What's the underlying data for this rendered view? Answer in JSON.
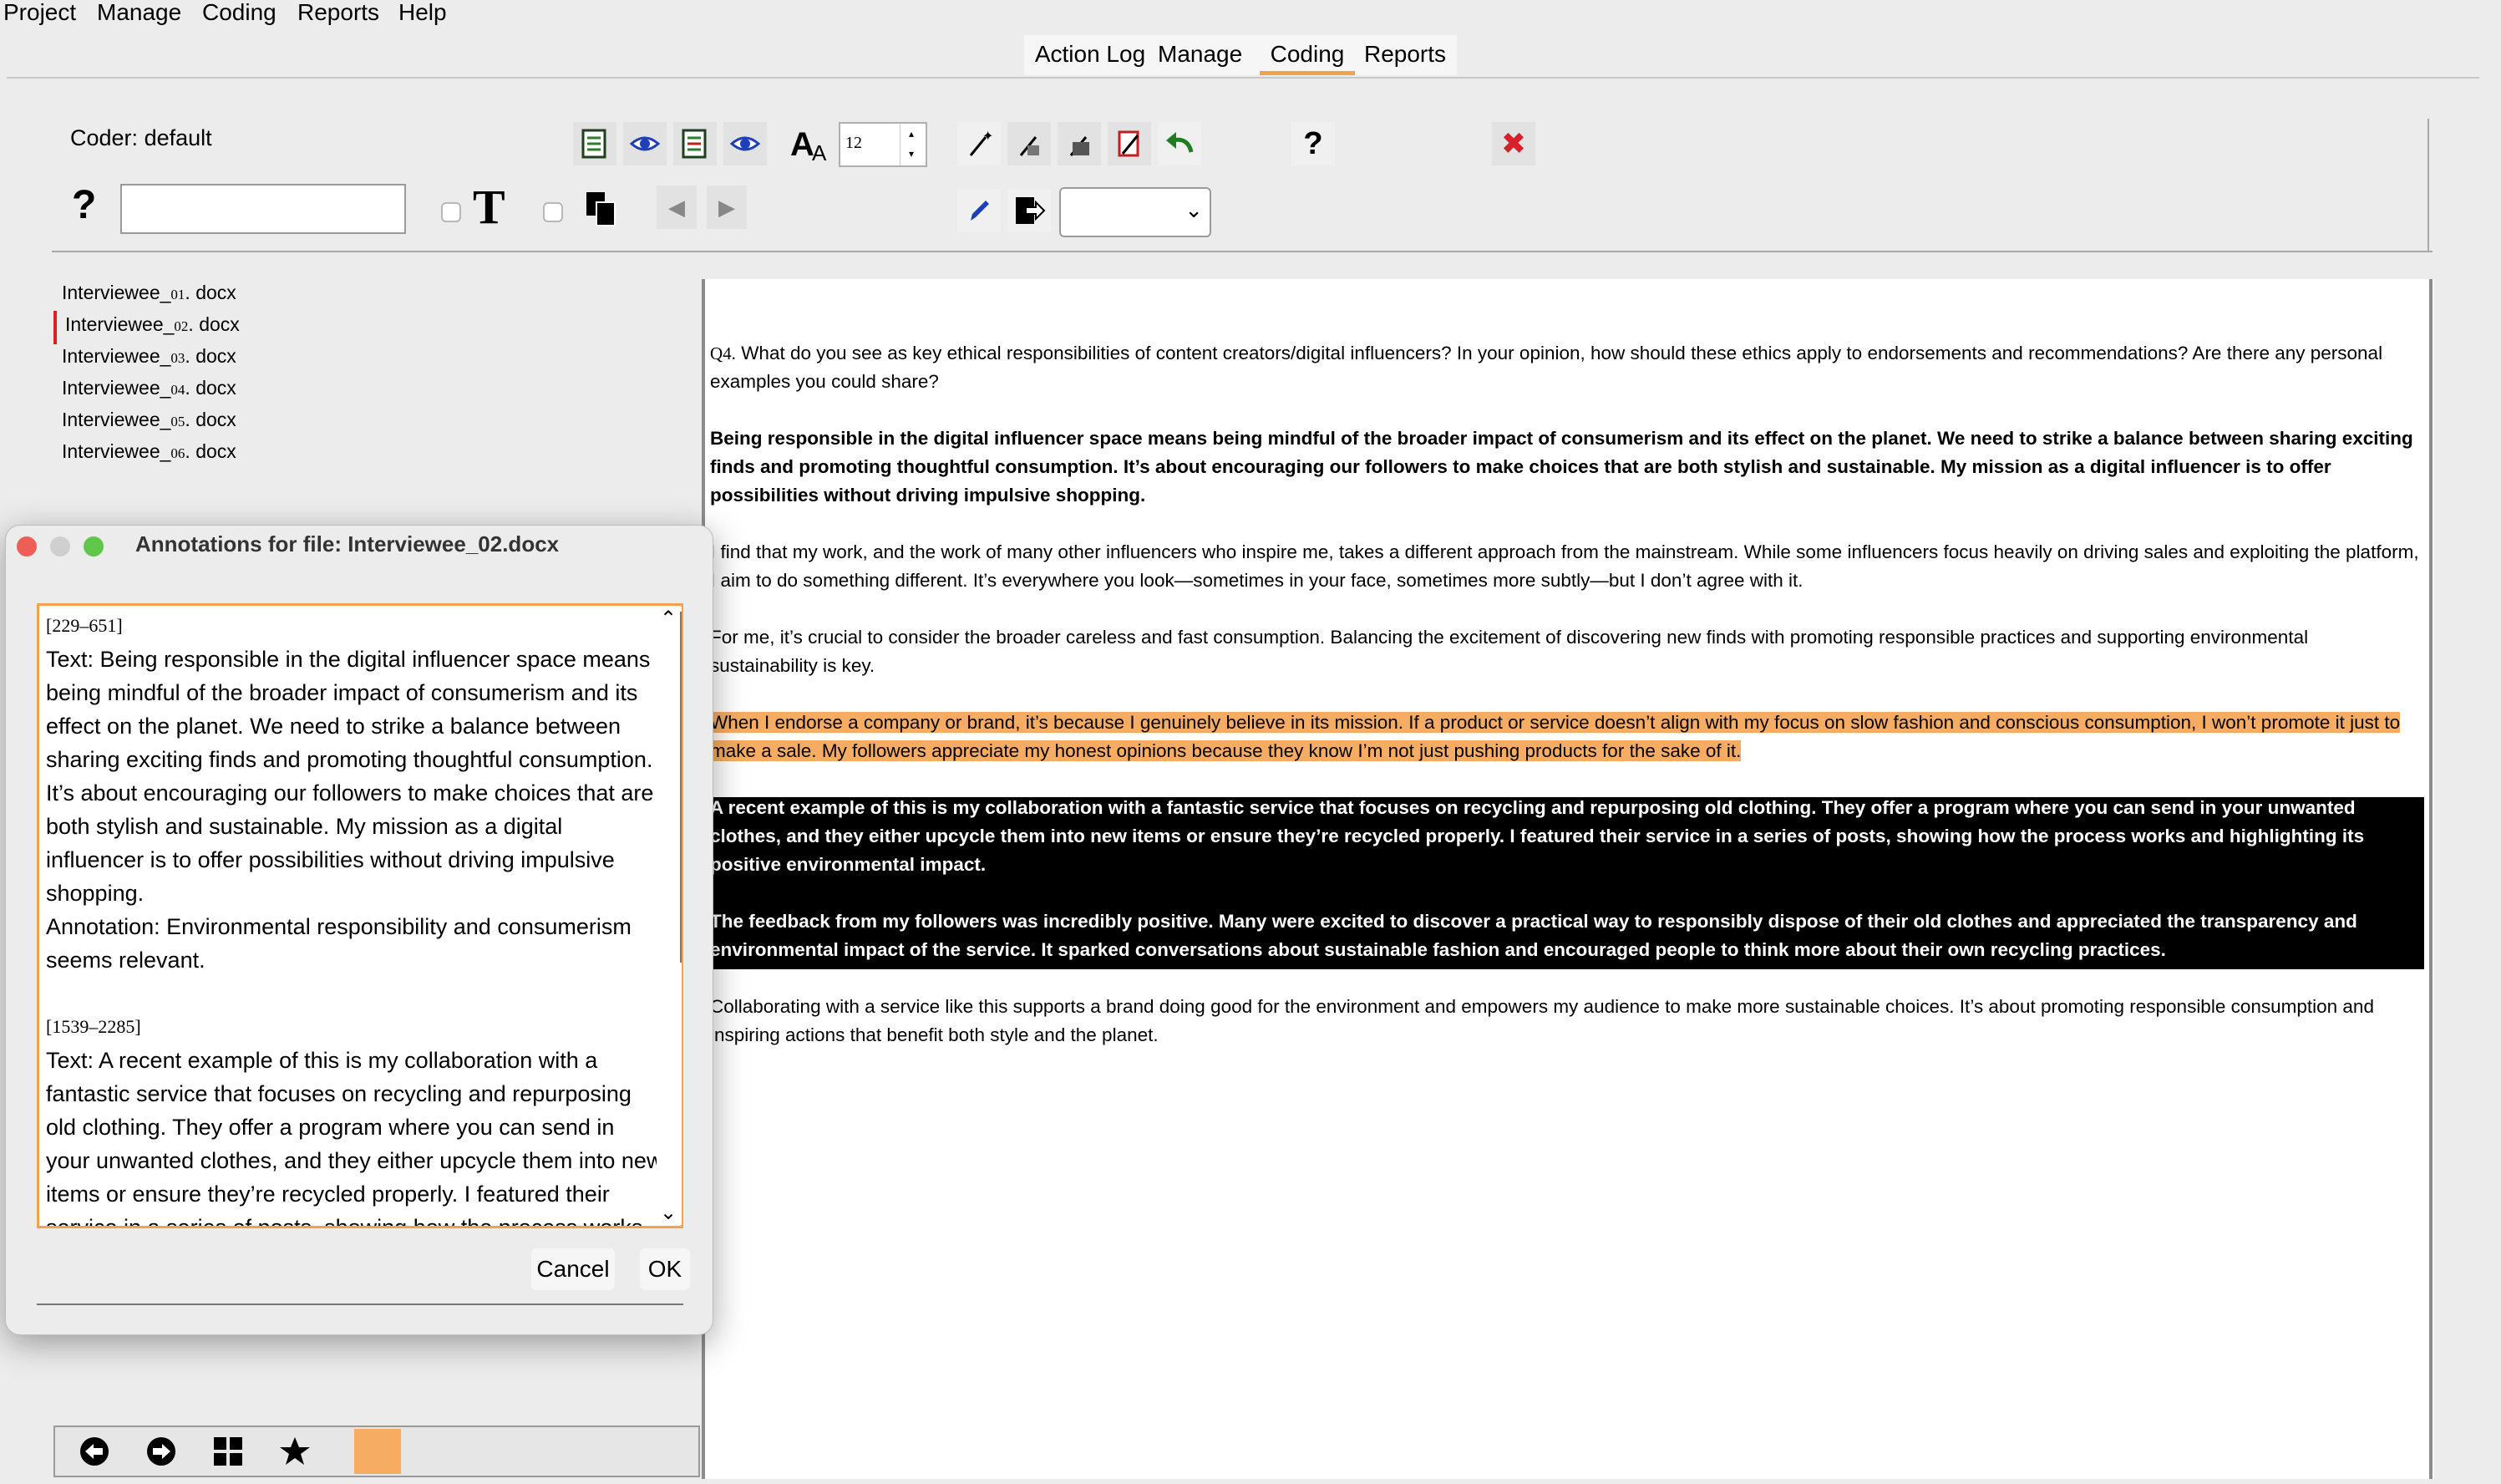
{
  "menubar": {
    "items": [
      "Project",
      "Manage",
      "Coding",
      "Reports",
      "Help"
    ]
  },
  "tabs": {
    "items": [
      "Action Log",
      "Manage",
      "Coding",
      "Reports"
    ],
    "active": "Coding"
  },
  "toolbar": {
    "coder_label": "Coder:",
    "coder_value": "default",
    "help_glyph": "?",
    "font_size_value": "12",
    "text_glyph": "T",
    "search_value": "",
    "help2_glyph": "?",
    "close_glyph": "✖",
    "dropdown_value": ""
  },
  "files": [
    {
      "prefix": "Interviewee_",
      "num": "01",
      "suffix": ". docx"
    },
    {
      "prefix": "Interviewee_",
      "num": "02",
      "suffix": ". docx"
    },
    {
      "prefix": "Interviewee_",
      "num": "03",
      "suffix": ". docx"
    },
    {
      "prefix": "Interviewee_",
      "num": "04",
      "suffix": ". docx"
    },
    {
      "prefix": "Interviewee_",
      "num": "05",
      "suffix": ". docx"
    },
    {
      "prefix": "Interviewee_",
      "num": "06",
      "suffix": ". docx"
    }
  ],
  "document": {
    "q_label": "Q4.",
    "question": "What do you see as key ethical responsibilities of content creators/digital influencers? In your opinion, how should these ethics apply to endorsements and recommendations? Are there any personal examples you could share?",
    "p1": "Being responsible in the digital influencer space means being mindful of the broader impact of consumerism and its effect on the planet.  We need to strike a balance between sharing exciting finds and promoting thoughtful consumption.  It’s about encouraging our followers to make choices that are both stylish and sustainable.  My mission as a digital influencer is to offer possibilities without driving impulsive shopping.",
    "p2": "I find that my work, and the work of many other influencers who inspire me, takes a different approach from the mainstream.  While some influencers focus heavily on driving sales and exploiting the platform, I aim to do something different.  It’s everywhere you look—sometimes in your face, sometimes more subtly—but I don’t agree with it.",
    "p3": "For me, it’s crucial to consider the broader careless and fast consumption.  Balancing the excitement of discovering new finds with promoting responsible practices and supporting environmental sustainability is key.",
    "p4": "When I endorse a company or brand, it’s because I genuinely believe in its mission.  If a product or service doesn’t align with my focus on slow fashion and conscious consumption, I won’t promote it just to make a sale.  My followers appreciate my honest opinions because they know I’m not just pushing products for the sake of it.",
    "p5": "A recent example of this is my collaboration with a fantastic service that focuses on recycling and repurposing old clothing.  They offer a program where you can send in your unwanted clothes, and they either upcycle them into new items or ensure they’re recycled properly.  I featured their service in a series of posts, showing how the process works and highlighting its positive environmental impact.",
    "p6": "The feedback from my followers was incredibly positive.  Many were excited to discover a practical way to responsibly dispose of their old clothes and appreciated the transparency and environmental impact of the service.  It sparked conversations about sustainable fashion and encouraged people to think more about their own recycling practices.",
    "p7": "Collaborating with a service like this supports a brand doing good for the environment and empowers my audience to make more sustainable choices.  It’s about promoting responsible consumption and inspiring actions that benefit both style and the planet."
  },
  "dialog": {
    "title": "Annotations for file: Interviewee_02.docx",
    "range1": "[229–651]",
    "text1": "Text:  Being responsible in the digital influencer space means being mindful of the broader impact of consumerism and its effect on the planet.  We need to strike a balance between sharing exciting finds and promoting thoughtful consumption.  It’s about encouraging our followers to make choices that are both stylish and sustainable.  My mission as a digital influencer is to offer possibilities without driving impulsive shopping.",
    "annotation1": "Annotation:  Environmental responsibility and consumerism seems relevant.",
    "range2": "[1539–2285]",
    "text2": "Text:  A recent example of this is my collaboration with a fantastic service that focuses on recycling and repurposing old clothing.  They offer a program where you can send in your unwanted clothes, and they either upcycle them into new items or ensure they’re recycled properly.  I featured their service in a series of posts, showing how the process works and highlighting its positive environmental impact.",
    "cancel": "Cancel",
    "ok": "OK"
  },
  "colors": {
    "accent": "#f5a04a",
    "highlight": "#f6ad63",
    "close_red": "#d8202a"
  },
  "icons": [
    "annotate-icon",
    "view-annotations-icon",
    "font-icon",
    "magic-wand-icon",
    "undo-icon",
    "pencil-icon",
    "export-icon",
    "back-arrow-icon",
    "forward-arrow-icon",
    "grid-icon",
    "star-icon"
  ]
}
